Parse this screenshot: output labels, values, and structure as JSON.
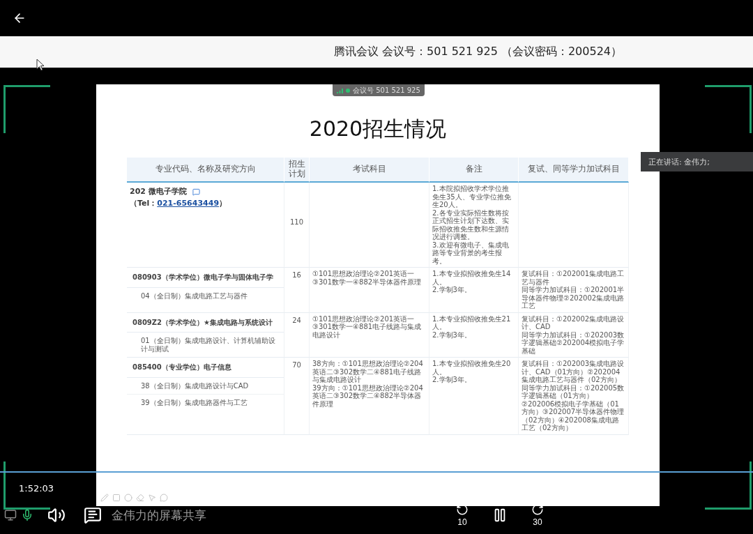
{
  "meeting_banner": "腾讯会议 会议号：501 521 925 （会议密码：200524）",
  "meeting_badge": "会议号 501 521 925",
  "speaker_tip": "正在讲话: 金伟力;",
  "slide": {
    "title": "2020招生情况",
    "table": {
      "columns": [
        "专业代码、名称及研究方向",
        "招生计划",
        "考试科目",
        "备注",
        "复试、同等学力加试科目"
      ],
      "department": {
        "name": "202 微电子学院",
        "tel_prefix": "（Tel：",
        "tel": "021-65643449",
        "tel_suffix": "）",
        "quota": "110",
        "notes": [
          "1.本院拟招收学术学位推免生35人、专业学位推免生20人。",
          "2.各专业实际招生数将按正式招生计划下达数、实际招收推免生数和生源情况进行调整。",
          "3.欢迎有微电子、集成电路等专业背景的考生报考。"
        ]
      },
      "majors": [
        {
          "name": "080903（学术学位）微电子学与固体电子学",
          "quota": "16",
          "exams": [
            "①101思想政治理论②201英语一③301数学一④882半导体器件原理"
          ],
          "notes": [
            "1.本专业拟招收推免生14人。",
            "2.学制3年。"
          ],
          "retest": [
            "复试科目：①202001集成电路工艺与器件",
            "同等学力加试科目：①202001半导体器件物理②202002集成电路工艺"
          ],
          "directions": [
            "04（全日制）集成电路工艺与器件"
          ]
        },
        {
          "name": "0809Z2（学术学位）★集成电路与系统设计",
          "quota": "24",
          "exams": [
            "①101思想政治理论②201英语一③301数学一④881电子线路与集成电路设计"
          ],
          "notes": [
            "1.本专业拟招收推免生21人。",
            "2.学制3年。"
          ],
          "retest": [
            "复试科目：①202002集成电路设计、CAD",
            "同等学力加试科目：①202003数字逻辑基础②202004模拟电子学基础"
          ],
          "directions": [
            "01（全日制）集成电路设计、计算机辅助设计与测试"
          ]
        },
        {
          "name": "085400（专业学位）电子信息",
          "quota": "70",
          "exams": [
            "38方向：①101思想政治理论②204英语二③302数学二④881电子线路与集成电路设计",
            "39方向：①101思想政治理论②204英语二③302数学二④882半导体器件原理"
          ],
          "notes": [
            "1.本专业拟招收推免生20人。",
            "2.学制3年。"
          ],
          "retest": [
            "复试科目：①202003集成电路设计、CAD（01方向）②202004集成电路工艺与器件（02方向）",
            "同等学力加试科目：①202005数字逻辑基础（01方向）②202006模拟电子学基础（01方向）③202007半导体器件物理（02方向）④202008集成电路工艺（02方向）"
          ],
          "directions": [
            "38（全日制）集成电路设计与CAD",
            "39（全日制）集成电路器件与工艺"
          ]
        }
      ]
    }
  },
  "player": {
    "time": "1:52:03",
    "level": 1,
    "playing": true,
    "share_label": "金伟力的屏幕共享",
    "skip_back": "10",
    "skip_forward": "30"
  }
}
